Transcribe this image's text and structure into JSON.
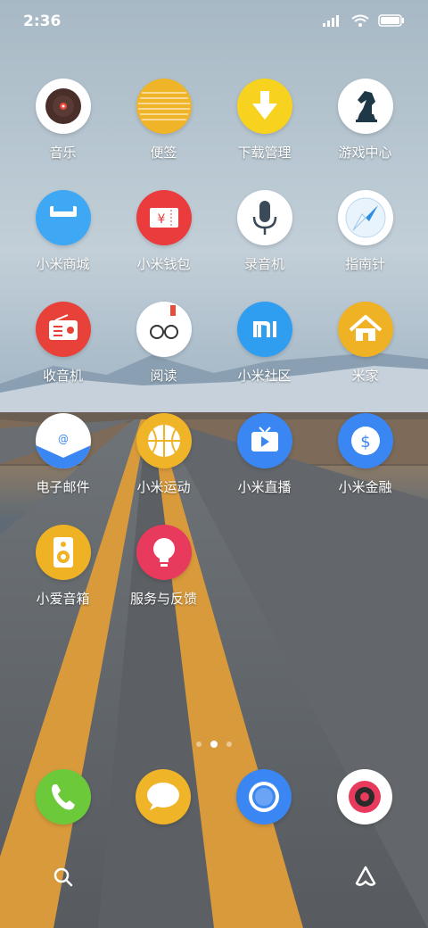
{
  "status_bar": {
    "time": "2:36",
    "icons": [
      "signal-icon",
      "wifi-icon",
      "battery-icon"
    ]
  },
  "apps": [
    {
      "label": "音乐",
      "icon": "vinyl-record-icon",
      "color": "#ffffff"
    },
    {
      "label": "便签",
      "icon": "notes-icon",
      "color": "#f0b429"
    },
    {
      "label": "下载管理",
      "icon": "download-arrow-icon",
      "color": "#f7d21e"
    },
    {
      "label": "游戏中心",
      "icon": "chess-knight-icon",
      "color": "#ffffff"
    },
    {
      "label": "小米商城",
      "icon": "shopping-bag-icon",
      "color": "#3ea8f4"
    },
    {
      "label": "小米钱包",
      "icon": "yuan-ticket-icon",
      "color": "#ea3c3c"
    },
    {
      "label": "录音机",
      "icon": "microphone-icon",
      "color": "#ffffff"
    },
    {
      "label": "指南针",
      "icon": "compass-icon",
      "color": "#ffffff"
    },
    {
      "label": "收音机",
      "icon": "radio-icon",
      "color": "#e8413a"
    },
    {
      "label": "阅读",
      "icon": "glasses-book-icon",
      "color": "#ffffff"
    },
    {
      "label": "小米社区",
      "icon": "mi-logo-icon",
      "color": "#2f9df0"
    },
    {
      "label": "米家",
      "icon": "home-icon",
      "color": "#efb224"
    },
    {
      "label": "电子邮件",
      "icon": "email-envelope-icon",
      "color": "#ffffff"
    },
    {
      "label": "小米运动",
      "icon": "basketball-icon",
      "color": "#f0b429"
    },
    {
      "label": "小米直播",
      "icon": "live-tv-icon",
      "color": "#3a86f2"
    },
    {
      "label": "小米金融",
      "icon": "dollar-coin-icon",
      "color": "#3a86f2"
    },
    {
      "label": "小爱音箱",
      "icon": "speaker-icon",
      "color": "#efb224"
    },
    {
      "label": "服务与反馈",
      "icon": "lightbulb-icon",
      "color": "#e83a5c"
    }
  ],
  "dock": [
    {
      "icon": "phone-icon",
      "color": "#6cc93a"
    },
    {
      "icon": "message-bubble-icon",
      "color": "#f0b429"
    },
    {
      "icon": "browser-icon",
      "color": "#3a86f2"
    },
    {
      "icon": "camera-icon",
      "color": "#ffffff"
    }
  ],
  "pager": {
    "pages": 3,
    "current": 2
  },
  "bottom": {
    "left_icon": "search-icon",
    "right_icon": "assistant-icon"
  }
}
